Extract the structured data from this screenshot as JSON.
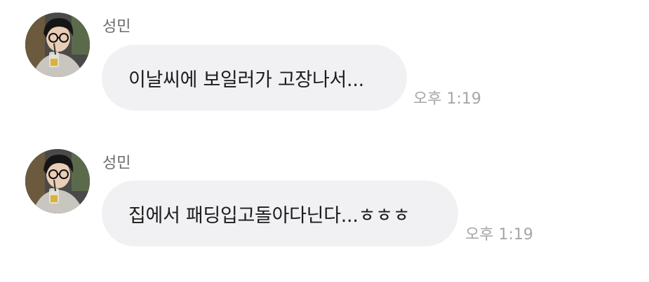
{
  "messages": [
    {
      "sender": "성민",
      "text": "이날씨에 보일러가 고장나서...",
      "time": "오후 1:19"
    },
    {
      "sender": "성민",
      "text": "집에서 패딩입고돌아다닌다...ㅎㅎㅎ",
      "time": "오후 1:19"
    }
  ],
  "colors": {
    "bubble": "#f1f1f3",
    "text": "#1c1c1c",
    "sender": "#6b6b6b",
    "time": "#a6a6a6"
  },
  "icons": {
    "avatar": "profile-photo-icon"
  }
}
